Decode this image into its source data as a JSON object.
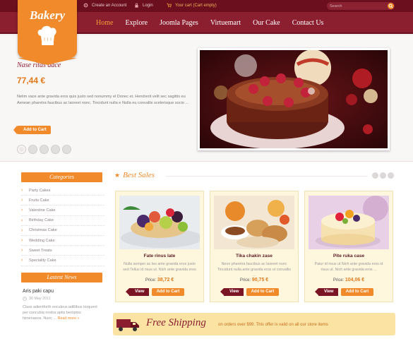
{
  "topbar": {
    "create_account": "Create an Account",
    "login": "Login",
    "cart": "Your cart (Cart empty)",
    "search_placeholder": "Search"
  },
  "logo": {
    "text": "Bakery"
  },
  "nav": [
    "Home",
    "Explore",
    "Joomla Pages",
    "Virtuemart",
    "Our Cake",
    "Contact Us"
  ],
  "hero": {
    "title": "Nase ritas dace",
    "price": "77,44 €",
    "text": "Nelim vace ante gravida eros quis justo sed nonummy el Donec et. Hendrerit velit sec sagittis eu Aenean pharetra faucibus ac laoreet nonc. Tincidunt nulla e Nulla eu convallis scelerisque socio ...",
    "add_to_cart": "Add to Cart"
  },
  "sidebar": {
    "categories_title": "Categories",
    "categories": [
      "Party Cakes",
      "Fruits Cake",
      "Valentine Cake",
      "Birthday Cake",
      "Christmas Cake",
      "Wedding Cake",
      "Sweet Treats",
      "Speciality Cake"
    ],
    "news_title": "Lastest News",
    "news_item": {
      "title": "Aris paki capu",
      "date": "30 May 2011",
      "text": "Class adientforth eoculeus adillibus torquent per concubia nostra aptis beroptos himenaeos. Nunc ...",
      "read_more": "Read more »"
    }
  },
  "best_sales": {
    "title": "Best Sales",
    "products": [
      {
        "name": "Fate rinus late",
        "desc": "Nulla semper ac leo ante gravida eros justo sed Tellus id risus ut. Nich ante gravida eros ...",
        "price_label": "Price:",
        "price": "38,72 €",
        "view": "View",
        "add": "Add to Cart"
      },
      {
        "name": "Tika chakin zase",
        "desc": "Neon pharetra faucibus ac laoreet nunc Tincidunt nulla ante gravida eros ut convallis ...",
        "price_label": "Price:",
        "price": "90,75 €",
        "view": "View",
        "add": "Add to Cart"
      },
      {
        "name": "Pite ruka case",
        "desc": "Patur id risus ut Nich ante gravida eros id risus ut. Nich ante gravida eros ...",
        "price_label": "Price:",
        "price": "104,06 €",
        "view": "View",
        "add": "Add to Cart"
      }
    ]
  },
  "shipping": {
    "title": "Free Shipping",
    "text": "on orders over $99. This offer is valid on all our store items"
  },
  "colors": {
    "maroon": "#8b1e2f",
    "orange": "#f08a2a",
    "cream": "#fff6de"
  }
}
